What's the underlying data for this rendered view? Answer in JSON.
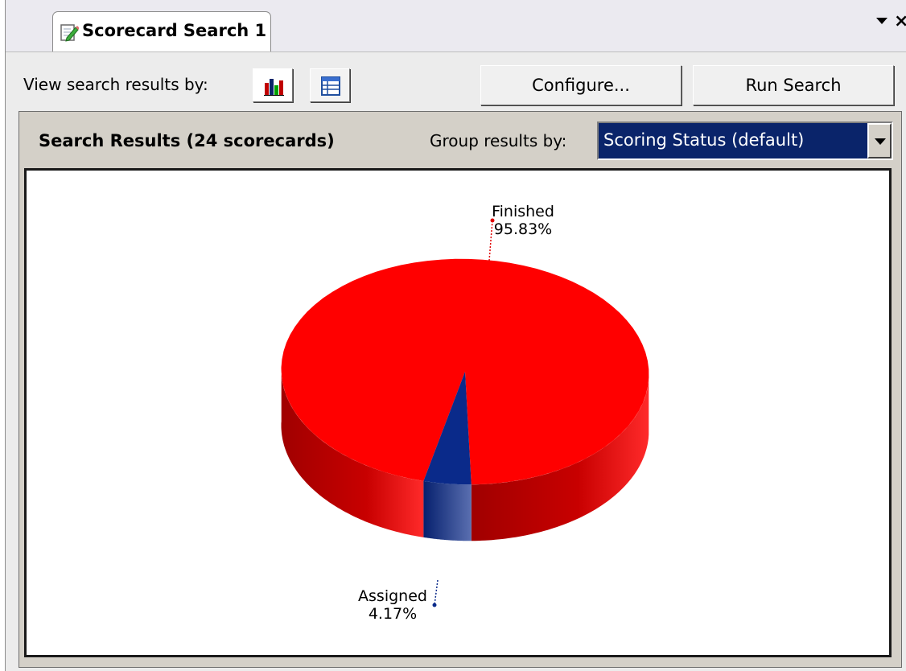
{
  "tab": {
    "title": "Scorecard Search 1",
    "icon": "edit-document-icon"
  },
  "toolbar": {
    "view_label": "View search results by:",
    "chart_view_icon": "bar-chart-icon",
    "table_view_icon": "table-grid-icon",
    "configure_label": "Configure...",
    "run_search_label": "Run Search"
  },
  "results": {
    "title": "Search Results (24 scorecards)",
    "group_label": "Group results by:",
    "group_value": "Scoring Status (default)"
  },
  "colors": {
    "finished": "#ff0000",
    "assigned": "#0a2a8a",
    "selection": "#0a246a"
  },
  "chart_data": {
    "type": "pie",
    "categories": [
      "Finished",
      "Assigned"
    ],
    "values": [
      95.83,
      4.17
    ],
    "value_labels": [
      "95.83%",
      "4.17%"
    ],
    "colors": [
      "#ff0000",
      "#0a2a8a"
    ],
    "style": "3d"
  }
}
